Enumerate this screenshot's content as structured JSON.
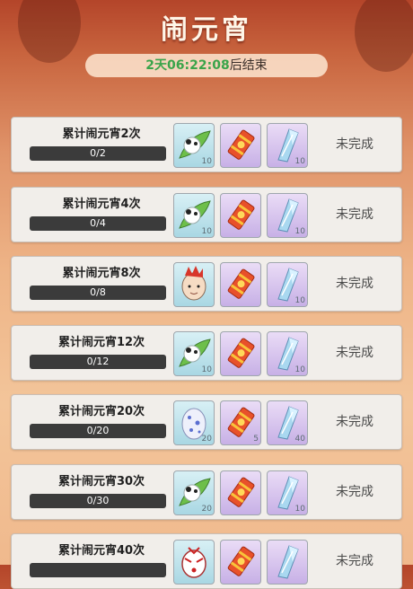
{
  "header": {
    "title": "闹元宵",
    "timer_value": "2天06:22:08",
    "timer_suffix": "后结束"
  },
  "tasks": [
    {
      "title": "累计闹元宵2次",
      "progress": "0/2",
      "status": "未完成",
      "rewards": [
        {
          "icon": "rice-ball-icon",
          "count": "10"
        },
        {
          "icon": "firecracker-icon",
          "count": ""
        },
        {
          "icon": "crystal-shard-icon",
          "count": "10"
        }
      ]
    },
    {
      "title": "累计闹元宵4次",
      "progress": "0/4",
      "status": "未完成",
      "rewards": [
        {
          "icon": "rice-ball-icon",
          "count": "10"
        },
        {
          "icon": "firecracker-icon",
          "count": ""
        },
        {
          "icon": "crystal-shard-icon",
          "count": "10"
        }
      ]
    },
    {
      "title": "累计闹元宵8次",
      "progress": "0/8",
      "status": "未完成",
      "rewards": [
        {
          "icon": "monk-avatar-icon",
          "count": ""
        },
        {
          "icon": "firecracker-icon",
          "count": ""
        },
        {
          "icon": "crystal-shard-icon",
          "count": "10"
        }
      ]
    },
    {
      "title": "累计闹元宵12次",
      "progress": "0/12",
      "status": "未完成",
      "rewards": [
        {
          "icon": "rice-ball-icon",
          "count": "10"
        },
        {
          "icon": "firecracker-icon",
          "count": ""
        },
        {
          "icon": "crystal-shard-icon",
          "count": "10"
        }
      ]
    },
    {
      "title": "累计闹元宵20次",
      "progress": "0/20",
      "status": "未完成",
      "rewards": [
        {
          "icon": "egg-icon",
          "count": "20"
        },
        {
          "icon": "firecracker-icon",
          "count": "5"
        },
        {
          "icon": "crystal-shard-icon",
          "count": "40"
        }
      ]
    },
    {
      "title": "累计闹元宵30次",
      "progress": "0/30",
      "status": "未完成",
      "rewards": [
        {
          "icon": "rice-ball-icon",
          "count": "20"
        },
        {
          "icon": "firecracker-icon",
          "count": ""
        },
        {
          "icon": "crystal-shard-icon",
          "count": "10"
        }
      ]
    },
    {
      "title": "累计闹元宵40次",
      "progress": "",
      "status": "未完成",
      "rewards": [
        {
          "icon": "mask-icon",
          "count": ""
        },
        {
          "icon": "firecracker-icon",
          "count": ""
        },
        {
          "icon": "crystal-shard-icon",
          "count": ""
        }
      ]
    }
  ],
  "colors": {
    "timer_green": "#3aa44a",
    "card_bg": "#f1eeea",
    "progress_bar": "#3b3b3b"
  }
}
